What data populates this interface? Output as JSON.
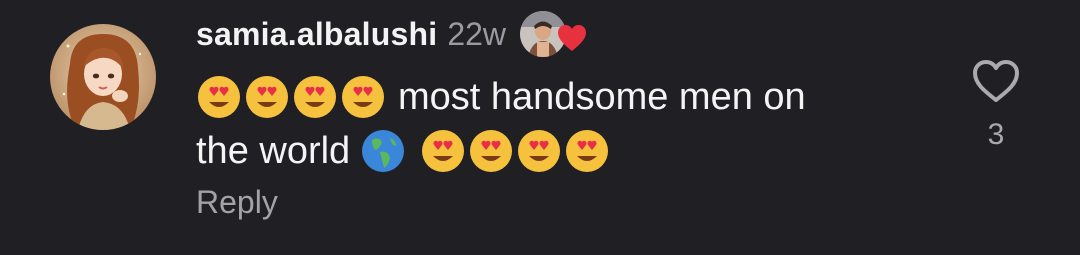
{
  "comment": {
    "username": "samia.albalushi",
    "timestamp": "22w",
    "text_line1": "most handsome men on",
    "text_line2": "the world",
    "emoji_before": "heart-eyes-emoji x4",
    "emoji_globe": "globe-americas-emoji",
    "emoji_after": "heart-eyes-emoji x4",
    "reply_label": "Reply",
    "like_count": "3",
    "liked_by_author": true
  },
  "icons": {
    "like": "heart-outline-icon",
    "author_like": "red-heart-icon"
  },
  "colors": {
    "background": "#1f1f24",
    "text": "#f4f4f4",
    "muted": "#9a9aa2",
    "heart_red": "#e8313f"
  }
}
